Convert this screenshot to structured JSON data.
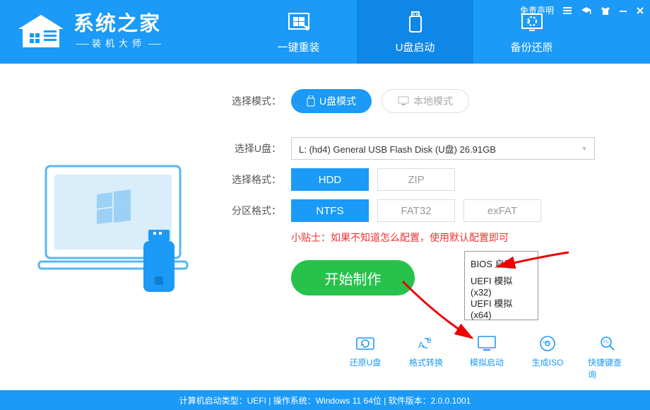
{
  "titlebar": {
    "disclaimer": "免责声明"
  },
  "logo": {
    "title": "系统之家",
    "subtitle": "装机大师"
  },
  "tabs": [
    {
      "label": "一键重装"
    },
    {
      "label": "U盘启动"
    },
    {
      "label": "备份还原"
    }
  ],
  "mode": {
    "label": "选择模式：",
    "usb": "U盘模式",
    "local": "本地模式"
  },
  "udisk": {
    "label": "选择U盘：",
    "value": "L: (hd4) General USB Flash Disk  (U盘) 26.91GB"
  },
  "format": {
    "label": "选择格式：",
    "hdd": "HDD",
    "zip": "ZIP"
  },
  "partition": {
    "label": "分区格式：",
    "ntfs": "NTFS",
    "fat32": "FAT32",
    "exfat": "exFAT"
  },
  "tip": "小贴士：如果不知道怎么配置，使用默认配置即可",
  "start": "开始制作",
  "boot_menu": {
    "bios": "BIOS 启动",
    "uefi32": "UEFI 模拟(x32)",
    "uefi64": "UEFI 模拟(x64)"
  },
  "tools": {
    "restore": "还原U盘",
    "convert": "格式转换",
    "simulate": "模拟启动",
    "iso": "生成ISO",
    "hotkey": "快捷键查询"
  },
  "status": "计算机启动类型：UEFI | 操作系统：Windows 11 64位 | 软件版本：2.0.0.1001"
}
